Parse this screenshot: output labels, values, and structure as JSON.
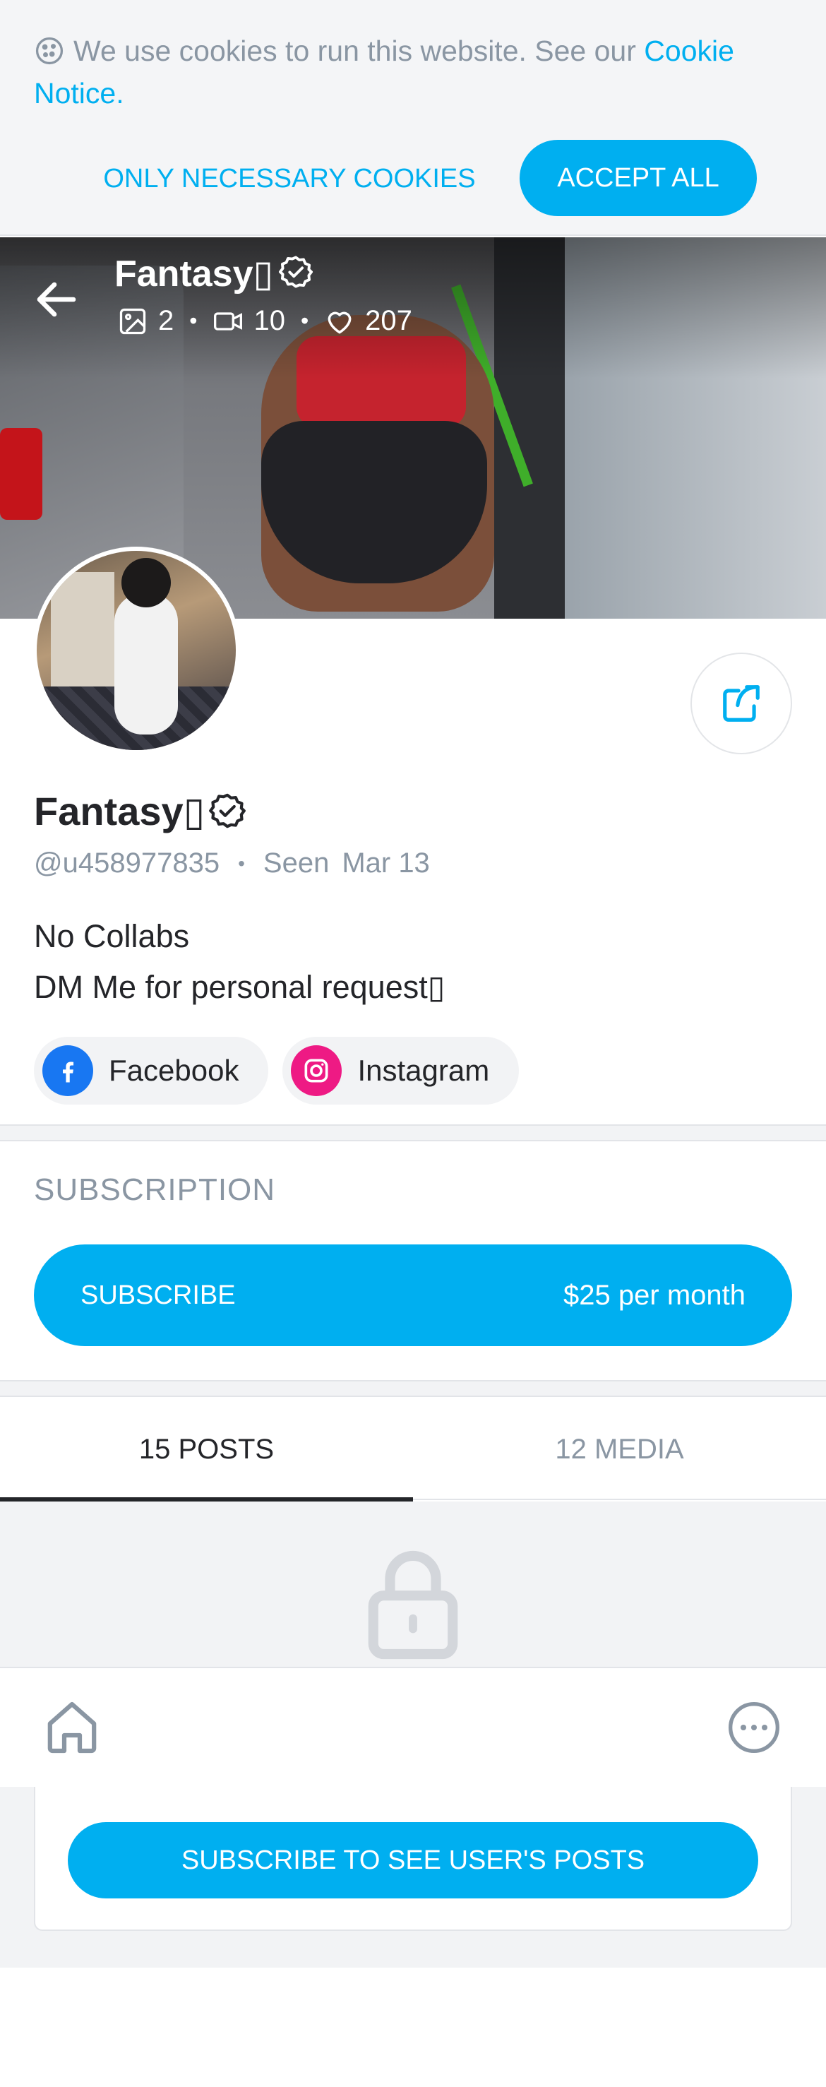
{
  "cookie_banner": {
    "text": "We use cookies to run this website. See our ",
    "link_text": "Cookie Notice",
    "text_end": ".",
    "necessary_label": "ONLY NECESSARY COOKIES",
    "accept_label": "ACCEPT ALL"
  },
  "header": {
    "name": "Fantasy▯",
    "photos": "2",
    "videos": "10",
    "likes": "207"
  },
  "profile": {
    "name": "Fantasy▯",
    "handle": "@u458977835",
    "seen_label": "Seen",
    "seen_date": "Mar 13",
    "bio_line1": "No Collabs",
    "bio_line2": "DM Me for personal request▯"
  },
  "socials": [
    {
      "label": "Facebook",
      "icon": "facebook-icon",
      "color": "#1877f2"
    },
    {
      "label": "Instagram",
      "icon": "instagram-icon",
      "color": "#ee1a84"
    }
  ],
  "subscription": {
    "title": "SUBSCRIPTION",
    "button_label": "SUBSCRIBE",
    "price": "$25 per month"
  },
  "tabs": [
    {
      "label": "15 POSTS",
      "active": true
    },
    {
      "label": "12 MEDIA",
      "active": false
    }
  ],
  "locked": {
    "button_label": "SUBSCRIBE TO SEE USER'S POSTS"
  },
  "colors": {
    "accent": "#00aff0",
    "text": "#242529",
    "muted": "#8a96a3"
  }
}
